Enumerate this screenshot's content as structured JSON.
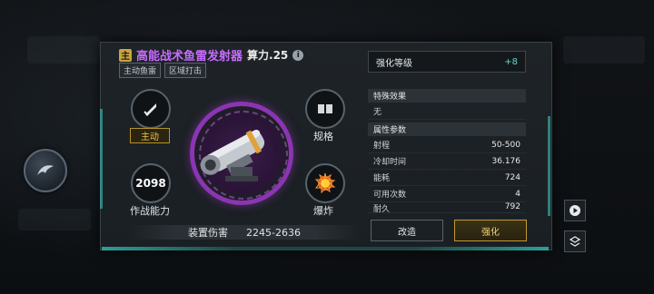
{
  "item": {
    "grade_tag": "主",
    "title": "高能战术鱼雷发射器",
    "power_label": "算力.25",
    "tags": [
      "主动鱼雷",
      "区域打击"
    ]
  },
  "left_nodes": {
    "active_label": "主动",
    "combat_value": "2098",
    "combat_label": "作战能力",
    "spec_label": "规格",
    "explode_label": "爆炸"
  },
  "damage": {
    "label": "装置伤害",
    "value": "2245-2636"
  },
  "enhance": {
    "label": "强化等级",
    "value": "+8"
  },
  "special": {
    "header": "特殊效果",
    "value": "无"
  },
  "attributes": {
    "header": "属性参数",
    "rows": [
      {
        "name": "射程",
        "value": "50-500"
      },
      {
        "name": "冷却时间",
        "value": "36.176"
      },
      {
        "name": "能耗",
        "value": "724"
      },
      {
        "name": "可用次数",
        "value": "4"
      },
      {
        "name": "耐久",
        "value": "792"
      }
    ]
  },
  "buttons": {
    "remodel": "改造",
    "enhance": "强化"
  },
  "colors": {
    "title": "#c76bff",
    "accent_teal": "#3fd1c4",
    "gold": "#c49a2d"
  },
  "icons": {
    "emblem": "faction-emblem-icon",
    "active": "missile-icon",
    "spec": "spec-boxes-icon",
    "explode": "explosion-icon",
    "info": "info-icon",
    "side_1": "play-icon",
    "side_2": "layers-icon"
  }
}
